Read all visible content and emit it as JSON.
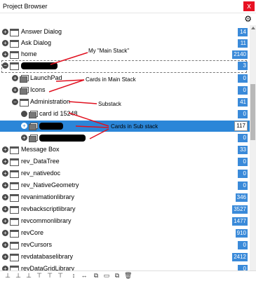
{
  "window": {
    "title": "Project Browser",
    "close_label": "x"
  },
  "toolbar": {
    "settings_icon": "gear-icon",
    "settings_glyph": "⚙"
  },
  "rows": [
    {
      "label": "Answer Dialog",
      "count": "14"
    },
    {
      "label": "Ask Dialog",
      "count": "11"
    },
    {
      "label": "home",
      "count": "2140"
    },
    {
      "label": "",
      "count": "3"
    },
    {
      "label": "LaunchPad",
      "count": "0"
    },
    {
      "label": "Icons",
      "count": "0"
    },
    {
      "label": "Administration",
      "count": "41"
    },
    {
      "label": "card id 15248",
      "count": "0"
    },
    {
      "label": "",
      "count": "117"
    },
    {
      "label": "",
      "count": "0"
    },
    {
      "label": "Message Box",
      "count": "33"
    },
    {
      "label": "rev_DataTree",
      "count": "0"
    },
    {
      "label": "rev_nativedoc",
      "count": "0"
    },
    {
      "label": "rev_NativeGeometry",
      "count": "0"
    },
    {
      "label": "revanimationlibrary",
      "count": "346"
    },
    {
      "label": "revbackscriptlibrary",
      "count": "3527"
    },
    {
      "label": "revcommonlibrary",
      "count": "1477"
    },
    {
      "label": "revCore",
      "count": "910"
    },
    {
      "label": "revCursors",
      "count": "0"
    },
    {
      "label": "revdatabaselibrary",
      "count": "2412"
    },
    {
      "label": "revDataGridLibrary",
      "count": "0"
    }
  ],
  "annotations": {
    "main_stack": "My \"Main Stack\"",
    "cards_main": "Cards in Main Stack",
    "substack": "Substack",
    "cards_sub": "Cards in Sub stack"
  },
  "colors": {
    "badge": "#3a8ad9",
    "selection": "#2b86d8",
    "close": "#e81123",
    "arrow": "#e0101f"
  }
}
